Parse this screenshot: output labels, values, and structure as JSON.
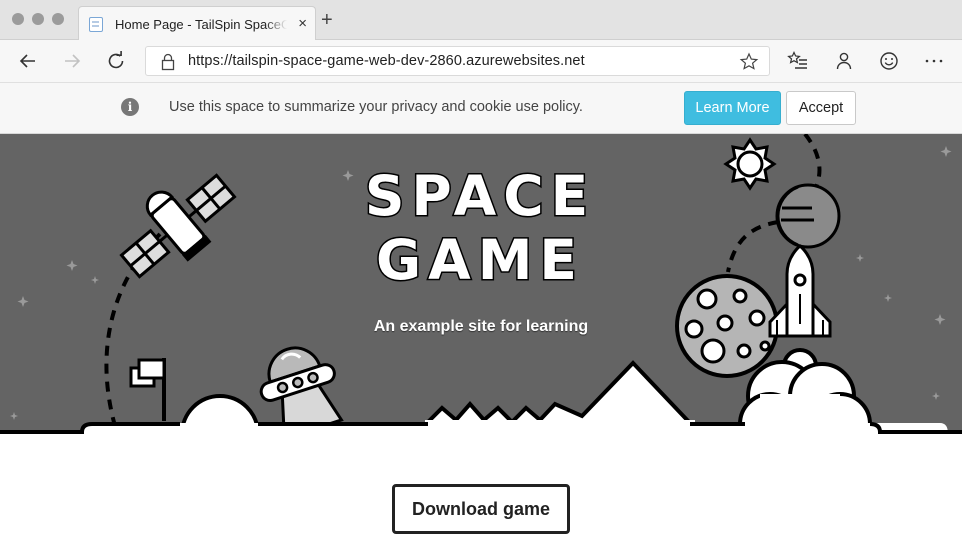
{
  "browser": {
    "tab": {
      "title": "Home Page - TailSpin SpaceGa",
      "favicon": "page-icon",
      "close": "×"
    },
    "new_tab": "+",
    "url": "https://tailspin-space-game-web-dev-2860.azurewebsites.net",
    "icons": [
      "back-icon",
      "forward-icon",
      "refresh-icon",
      "lock-icon",
      "favorite-star-icon",
      "favorites-list-icon",
      "profile-icon",
      "feedback-smiley-icon",
      "more-icon"
    ]
  },
  "cookie_banner": {
    "icon": "info-icon",
    "icon_glyph": "i",
    "text": "Use this space to summarize your privacy and cookie use policy.",
    "learn_more": "Learn More",
    "accept": "Accept",
    "accent_color": "#3fbde0"
  },
  "hero": {
    "title_line1": "SPACE",
    "title_line2": "GAME",
    "subtitle": "An example site for learning",
    "background_color": "#646464"
  },
  "main": {
    "download_button": "Download game"
  }
}
